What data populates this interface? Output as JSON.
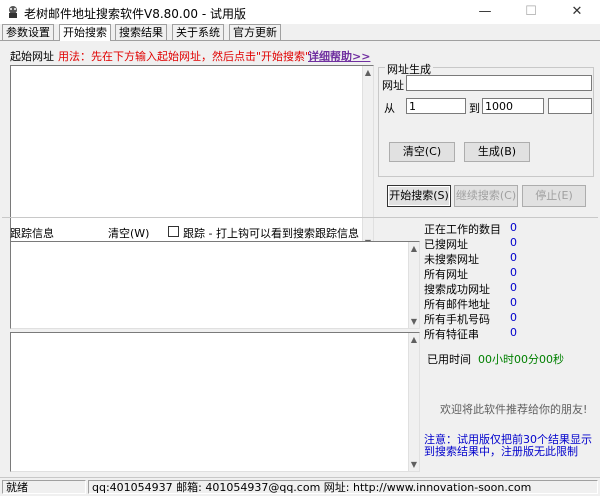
{
  "window": {
    "title": "老树邮件地址搜索软件V8.80.00 - 试用版",
    "minimize": "—",
    "maximize": "☐",
    "close": "✕"
  },
  "tabs": [
    {
      "label": "参数设置",
      "active": false
    },
    {
      "label": "开始搜索",
      "active": true
    },
    {
      "label": "搜索结果",
      "active": false
    },
    {
      "label": "关于系统",
      "active": false
    },
    {
      "label": "官方更新",
      "active": false
    }
  ],
  "start": {
    "label": "起始网址",
    "usage": "用法：先在下方输入起始网址，然后点击\"开始搜索\"",
    "help_link": "详细帮助>>"
  },
  "url_gen": {
    "group_title": "网址生成",
    "url_label": "网址",
    "url_value": "",
    "from_label": "从",
    "from_value": "1",
    "to_label": "到",
    "to_value": "1000",
    "step_value": "",
    "clear_button": "清空(C)",
    "generate_button": "生成(B)"
  },
  "actions": {
    "start_search": "开始搜索(S)",
    "continue_search": "继续搜索(C)",
    "stop": "停止(E)"
  },
  "trace": {
    "label": "跟踪信息",
    "clear": "清空(W)",
    "checkbox_label": "跟踪 - 打上钩可以看到搜索跟踪信息",
    "checked": false
  },
  "stats": [
    {
      "label": "正在工作的数目",
      "value": "0"
    },
    {
      "label": "已搜网址",
      "value": "0"
    },
    {
      "label": "未搜索网址",
      "value": "0"
    },
    {
      "label": "所有网址",
      "value": "0"
    },
    {
      "label": "搜索成功网址",
      "value": "0"
    },
    {
      "label": "所有邮件地址",
      "value": "0"
    },
    {
      "label": "所有手机号码",
      "value": "0"
    },
    {
      "label": "所有特征串",
      "value": "0"
    }
  ],
  "elapsed": {
    "label": "已用时间",
    "value": "00小时00分00秒"
  },
  "recommend": "欢迎将此软件推荐给你的朋友!",
  "notice": "注意：试用版仅把前30个结果显示到搜索结果中，注册版无此限制",
  "status": {
    "state": "就绪",
    "contact": "qq:401054937  邮箱: 401054937@qq.com  网址: http://www.innovation-soon.com"
  },
  "colors": {
    "usage_text": "#e00000",
    "help_link": "#7030a0",
    "stat_value": "#0000cc",
    "elapsed_value": "#008000",
    "notice_text": "#0000cc"
  }
}
